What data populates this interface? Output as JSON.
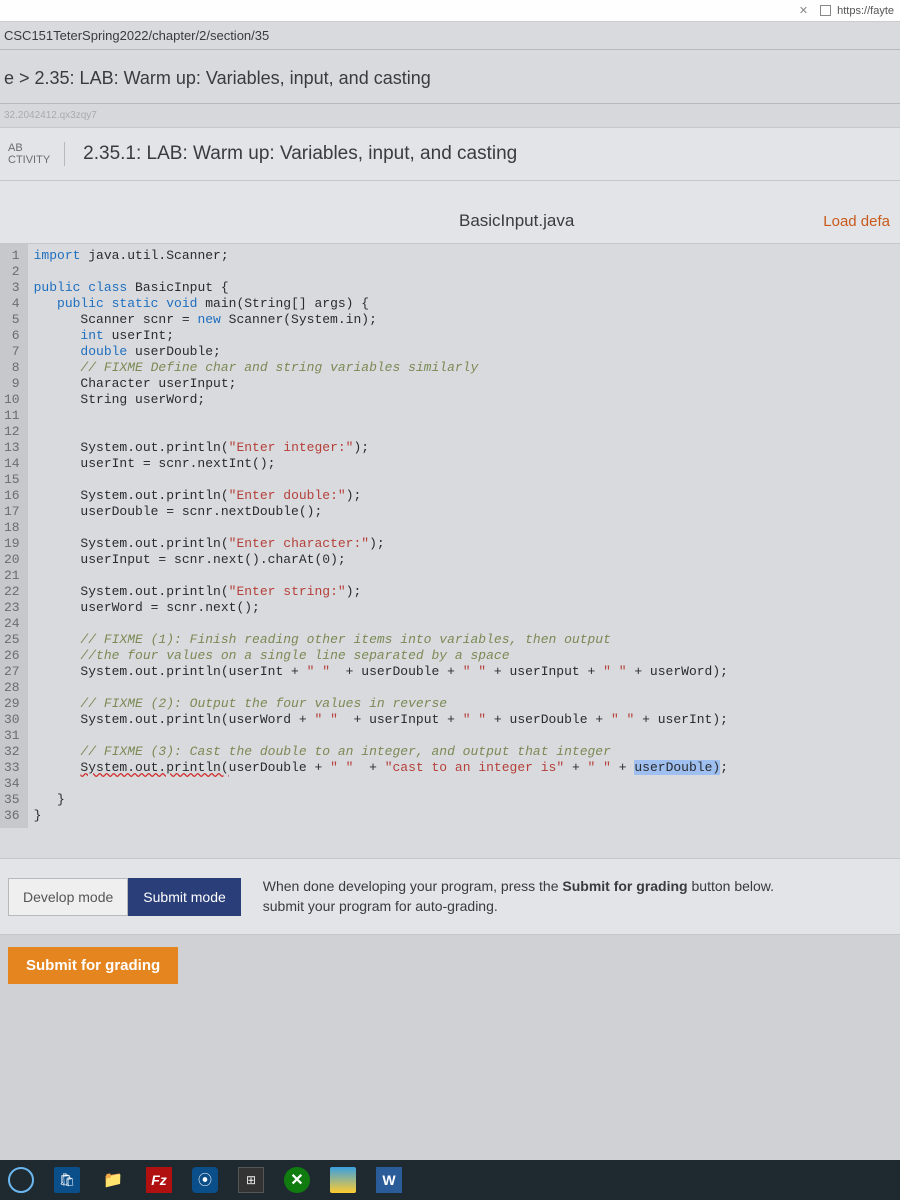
{
  "topbar": {
    "close": "✕",
    "url_fragment": "https://fayte"
  },
  "breadcrumb": "CSC151TeterSpring2022/chapter/2/section/35",
  "nav_path": "e > 2.35: LAB: Warm up: Variables, input, and casting",
  "watermark": "32.2042412.qx3zqy7",
  "activity": {
    "label_line1": "AB",
    "label_line2": "CTIVITY",
    "title": "2.35.1: LAB: Warm up: Variables, input, and casting"
  },
  "file": {
    "name": "BasicInput.java",
    "load_default": "Load defa"
  },
  "code_lines": 36,
  "modes": {
    "develop": "Develop mode",
    "submit": "Submit mode",
    "text_prefix": "When done developing your program, press the ",
    "text_bold": "Submit for grading",
    "text_suffix_1": " button below.",
    "text_line2": "submit your program for auto-grading."
  },
  "submit_button": "Submit for grading",
  "taskbar": {
    "fz": "Fz",
    "outlook": "⦿",
    "xbox": "✕",
    "word": "W"
  }
}
